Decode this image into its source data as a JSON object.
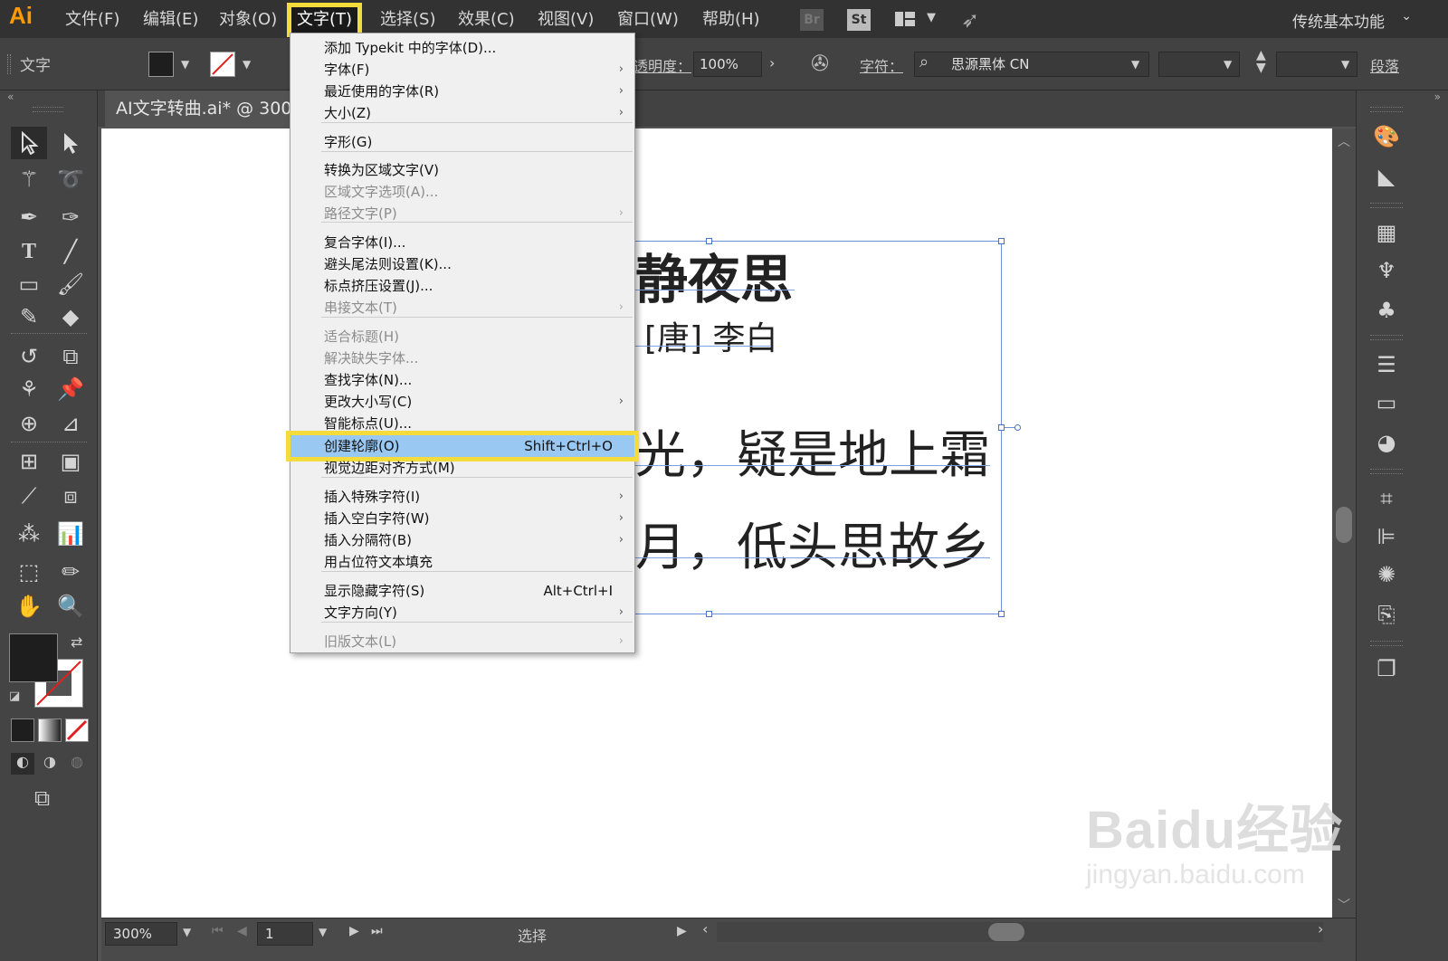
{
  "menubar": {
    "logo": "Ai",
    "items": [
      "文件(F)",
      "编辑(E)",
      "对象(O)",
      "文字(T)",
      "选择(S)",
      "效果(C)",
      "视图(V)",
      "窗口(W)",
      "帮助(H)"
    ],
    "br_label": "Br",
    "st_label": "St",
    "workspace": "传统基本功能"
  },
  "controlbar": {
    "tool_name": "文字",
    "opacity_label": "透明度：",
    "opacity_value": "100%",
    "char_label": "字符：",
    "font_name": "思源黑体 CN",
    "paragraph_label": "段落"
  },
  "document": {
    "tab_title": "AI文字转曲.ai* @ 300%"
  },
  "poem": {
    "title": "静夜思",
    "author": "[唐] 李白",
    "line1": "光，疑是地上霜",
    "line2": "月，低头思故乡"
  },
  "statusbar": {
    "zoom": "300%",
    "page": "1",
    "tool_status": "选择"
  },
  "watermark": {
    "main": "Baidu经验",
    "sub": "jingyan.baidu.com"
  },
  "dropdown": {
    "items": [
      {
        "label": "添加 Typekit 中的字体(D)...",
        "shortcut": "",
        "arrow": false,
        "disabled": false
      },
      {
        "label": "字体(F)",
        "shortcut": "",
        "arrow": true,
        "disabled": false
      },
      {
        "label": "最近使用的字体(R)",
        "shortcut": "",
        "arrow": true,
        "disabled": false
      },
      {
        "label": "大小(Z)",
        "shortcut": "",
        "arrow": true,
        "disabled": false
      },
      {
        "label": "字形(G)",
        "shortcut": "",
        "arrow": false,
        "disabled": false
      },
      {
        "label": "转换为区域文字(V)",
        "shortcut": "",
        "arrow": false,
        "disabled": false
      },
      {
        "label": "区域文字选项(A)...",
        "shortcut": "",
        "arrow": false,
        "disabled": true
      },
      {
        "label": "路径文字(P)",
        "shortcut": "",
        "arrow": true,
        "disabled": true
      },
      {
        "label": "复合字体(I)...",
        "shortcut": "",
        "arrow": false,
        "disabled": false
      },
      {
        "label": "避头尾法则设置(K)...",
        "shortcut": "",
        "arrow": false,
        "disabled": false
      },
      {
        "label": "标点挤压设置(J)...",
        "shortcut": "",
        "arrow": false,
        "disabled": false
      },
      {
        "label": "串接文本(T)",
        "shortcut": "",
        "arrow": true,
        "disabled": true
      },
      {
        "label": "适合标题(H)",
        "shortcut": "",
        "arrow": false,
        "disabled": true
      },
      {
        "label": "解决缺失字体...",
        "shortcut": "",
        "arrow": false,
        "disabled": true
      },
      {
        "label": "查找字体(N)...",
        "shortcut": "",
        "arrow": false,
        "disabled": false
      },
      {
        "label": "更改大小写(C)",
        "shortcut": "",
        "arrow": true,
        "disabled": false
      },
      {
        "label": "智能标点(U)...",
        "shortcut": "",
        "arrow": false,
        "disabled": false
      },
      {
        "label": "创建轮廓(O)",
        "shortcut": "Shift+Ctrl+O",
        "arrow": false,
        "disabled": false
      },
      {
        "label": "视觉边距对齐方式(M)",
        "shortcut": "",
        "arrow": false,
        "disabled": false
      },
      {
        "label": "插入特殊字符(I)",
        "shortcut": "",
        "arrow": true,
        "disabled": false
      },
      {
        "label": "插入空白字符(W)",
        "shortcut": "",
        "arrow": true,
        "disabled": false
      },
      {
        "label": "插入分隔符(B)",
        "shortcut": "",
        "arrow": true,
        "disabled": false
      },
      {
        "label": "用占位符文本填充",
        "shortcut": "",
        "arrow": false,
        "disabled": false
      },
      {
        "label": "显示隐藏字符(S)",
        "shortcut": "Alt+Ctrl+I",
        "arrow": false,
        "disabled": false
      },
      {
        "label": "文字方向(Y)",
        "shortcut": "",
        "arrow": true,
        "disabled": false
      },
      {
        "label": "旧版文本(L)",
        "shortcut": "",
        "arrow": true,
        "disabled": true
      }
    ]
  },
  "colors": {
    "highlight_outline": "#f3dc3b",
    "menu_selection": "#99c9f2",
    "logo_orange": "#ff9a00",
    "selection_blue": "#6f8fd6"
  },
  "icons": [
    "selection-icon",
    "direct-selection-icon",
    "magic-wand-icon",
    "lasso-icon",
    "pen-icon",
    "curvature-icon",
    "type-icon",
    "line-icon",
    "rectangle-icon",
    "paintbrush-icon",
    "shaper-icon",
    "eraser-icon",
    "rotate-icon",
    "scale-icon",
    "warp-icon",
    "puppet-warp-icon",
    "shape-builder-icon",
    "perspective-icon",
    "mesh-icon",
    "gradient-icon",
    "eyedropper-icon",
    "blend-icon",
    "symbol-sprayer-icon",
    "column-graph-icon",
    "artboard-icon",
    "slice-icon",
    "hand-icon",
    "zoom-icon"
  ]
}
